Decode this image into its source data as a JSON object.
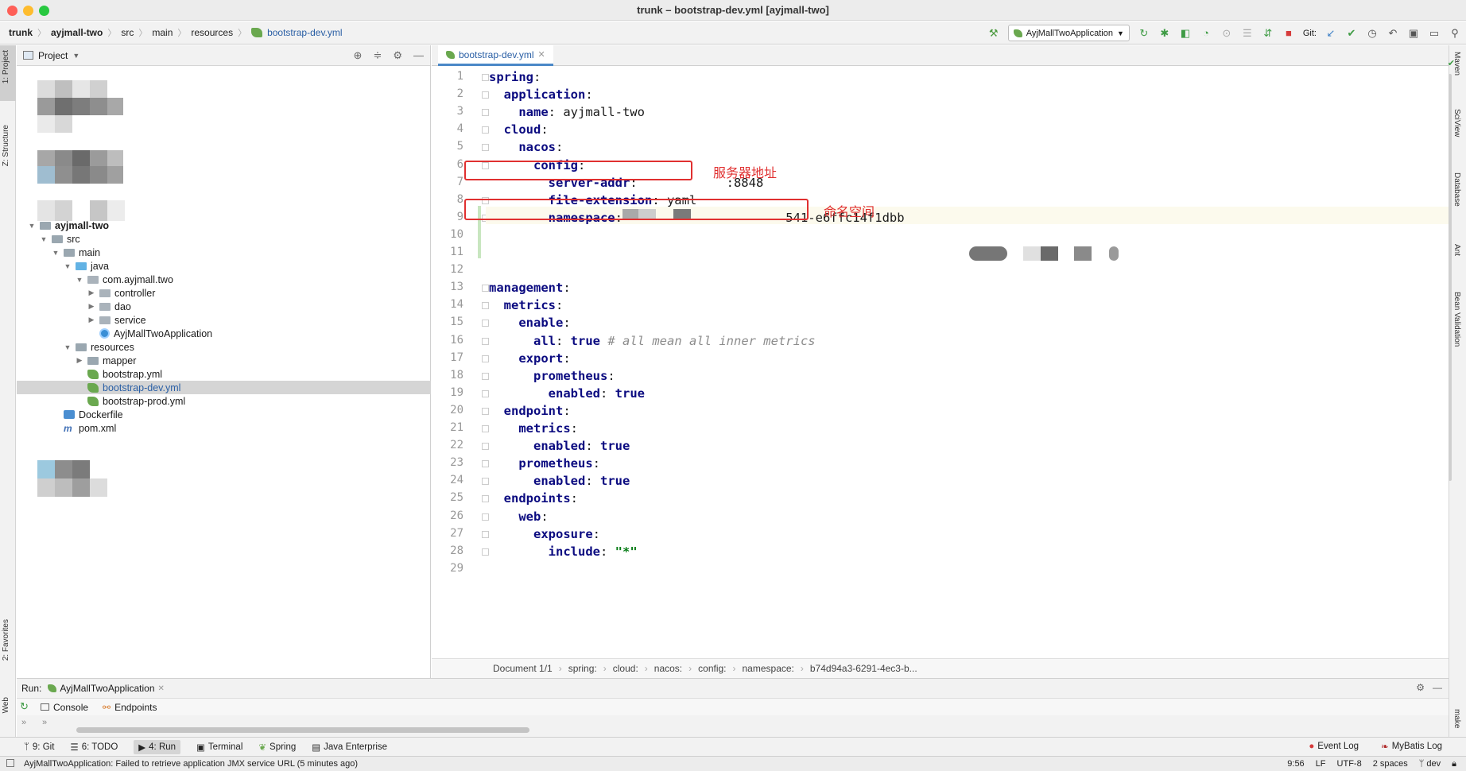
{
  "window": {
    "title": "trunk – bootstrap-dev.yml [ayjmall-two]"
  },
  "navbar": {
    "crumbs": [
      "trunk",
      "ayjmall-two",
      "src",
      "main",
      "resources",
      "bootstrap-dev.yml"
    ],
    "run_config": "AyjMallTwoApplication",
    "git_label": "Git:"
  },
  "left_stripe": {
    "project": "1: Project",
    "structure": "Z: Structure",
    "favorites": "2: Favorites",
    "web": "Web"
  },
  "right_stripe": {
    "maven": "Maven",
    "sciview": "SciView",
    "database": "Database",
    "ant": "Ant",
    "bean": "Bean Validation",
    "make": "make"
  },
  "project_panel": {
    "title": "Project",
    "tree": [
      {
        "label": "ayjmall-two",
        "depth": 0,
        "arrow": "▼",
        "icon": "folder",
        "bold": true
      },
      {
        "label": "src",
        "depth": 1,
        "arrow": "▼",
        "icon": "folder"
      },
      {
        "label": "main",
        "depth": 2,
        "arrow": "▼",
        "icon": "folder"
      },
      {
        "label": "java",
        "depth": 3,
        "arrow": "▼",
        "icon": "folder-blue"
      },
      {
        "label": "com.ayjmall.two",
        "depth": 4,
        "arrow": "▼",
        "icon": "package"
      },
      {
        "label": "controller",
        "depth": 5,
        "arrow": "▶",
        "icon": "package"
      },
      {
        "label": "dao",
        "depth": 5,
        "arrow": "▶",
        "icon": "package"
      },
      {
        "label": "service",
        "depth": 5,
        "arrow": "▶",
        "icon": "package"
      },
      {
        "label": "AyjMallTwoApplication",
        "depth": 5,
        "arrow": "",
        "icon": "class"
      },
      {
        "label": "resources",
        "depth": 3,
        "arrow": "▼",
        "icon": "folder"
      },
      {
        "label": "mapper",
        "depth": 4,
        "arrow": "▶",
        "icon": "folder"
      },
      {
        "label": "bootstrap.yml",
        "depth": 4,
        "arrow": "",
        "icon": "yml"
      },
      {
        "label": "bootstrap-dev.yml",
        "depth": 4,
        "arrow": "",
        "icon": "yml",
        "selected": true
      },
      {
        "label": "bootstrap-prod.yml",
        "depth": 4,
        "arrow": "",
        "icon": "yml"
      },
      {
        "label": "Dockerfile",
        "depth": 2,
        "arrow": "",
        "icon": "docker"
      },
      {
        "label": "pom.xml",
        "depth": 2,
        "arrow": "",
        "icon": "maven"
      }
    ]
  },
  "editor": {
    "tab_label": "bootstrap-dev.yml",
    "lines": [
      {
        "n": "1",
        "html": "<span class='k'>spring</span>:"
      },
      {
        "n": "2",
        "html": "  <span class='k'>application</span>:"
      },
      {
        "n": "3",
        "html": "    <span class='k'>name</span>: ayjmall-two"
      },
      {
        "n": "4",
        "html": "  <span class='k'>cloud</span>:"
      },
      {
        "n": "5",
        "html": "    <span class='k'>nacos</span>:"
      },
      {
        "n": "6",
        "html": "      <span class='k'>config</span>:"
      },
      {
        "n": "7",
        "html": "        <span class='k'>server-addr</span>:            :8848"
      },
      {
        "n": "8",
        "html": "        <span class='k'>file-extension</span>: yaml"
      },
      {
        "n": "9",
        "html": "        <span class='k'>namespace</span>:                      541-e6ffc14f1dbb"
      },
      {
        "n": "10",
        "html": ""
      },
      {
        "n": "11",
        "html": ""
      },
      {
        "n": "12",
        "html": ""
      },
      {
        "n": "13",
        "html": "<span class='k'>management</span>:"
      },
      {
        "n": "14",
        "html": "  <span class='k'>metrics</span>:"
      },
      {
        "n": "15",
        "html": "    <span class='k'>enable</span>:"
      },
      {
        "n": "16",
        "html": "      <span class='k'>all</span>: <span class='kw'>true</span> <span class='cmt'># all mean all inner metrics</span>"
      },
      {
        "n": "17",
        "html": "    <span class='k'>export</span>:"
      },
      {
        "n": "18",
        "html": "      <span class='k'>prometheus</span>:"
      },
      {
        "n": "19",
        "html": "        <span class='k'>enabled</span>: <span class='kw'>true</span>"
      },
      {
        "n": "20",
        "html": "  <span class='k'>endpoint</span>:"
      },
      {
        "n": "21",
        "html": "    <span class='k'>metrics</span>:"
      },
      {
        "n": "22",
        "html": "      <span class='k'>enabled</span>: <span class='kw'>true</span>"
      },
      {
        "n": "23",
        "html": "    <span class='k'>prometheus</span>:"
      },
      {
        "n": "24",
        "html": "      <span class='k'>enabled</span>: <span class='kw'>true</span>"
      },
      {
        "n": "25",
        "html": "  <span class='k'>endpoints</span>:"
      },
      {
        "n": "26",
        "html": "    <span class='k'>web</span>:"
      },
      {
        "n": "27",
        "html": "      <span class='k'>exposure</span>:"
      },
      {
        "n": "28",
        "html": "        <span class='k'>include</span>: <span class='str'>\"*\"</span>"
      },
      {
        "n": "29",
        "html": ""
      }
    ],
    "annotations": {
      "server_addr": "服务器地址",
      "namespace": "命名空间"
    },
    "breadcrumb": [
      "Document 1/1",
      "spring:",
      "cloud:",
      "nacos:",
      "config:",
      "namespace:",
      "b74d94a3-6291-4ec3-b..."
    ]
  },
  "run_panel": {
    "label": "Run:",
    "config_tab": "AyjMallTwoApplication",
    "tabs": [
      "Console",
      "Endpoints"
    ]
  },
  "tool_strip": {
    "left": [
      "9: Git",
      "6: TODO",
      "4: Run",
      "Terminal",
      "Spring",
      "Java Enterprise"
    ],
    "right": [
      "Event Log",
      "MyBatis Log"
    ]
  },
  "status_bar": {
    "message": "AyjMallTwoApplication: Failed to retrieve application JMX service URL (5 minutes ago)",
    "position": "9:56",
    "line_sep": "LF",
    "encoding": "UTF-8",
    "indent": "2 spaces",
    "branch": "dev"
  }
}
